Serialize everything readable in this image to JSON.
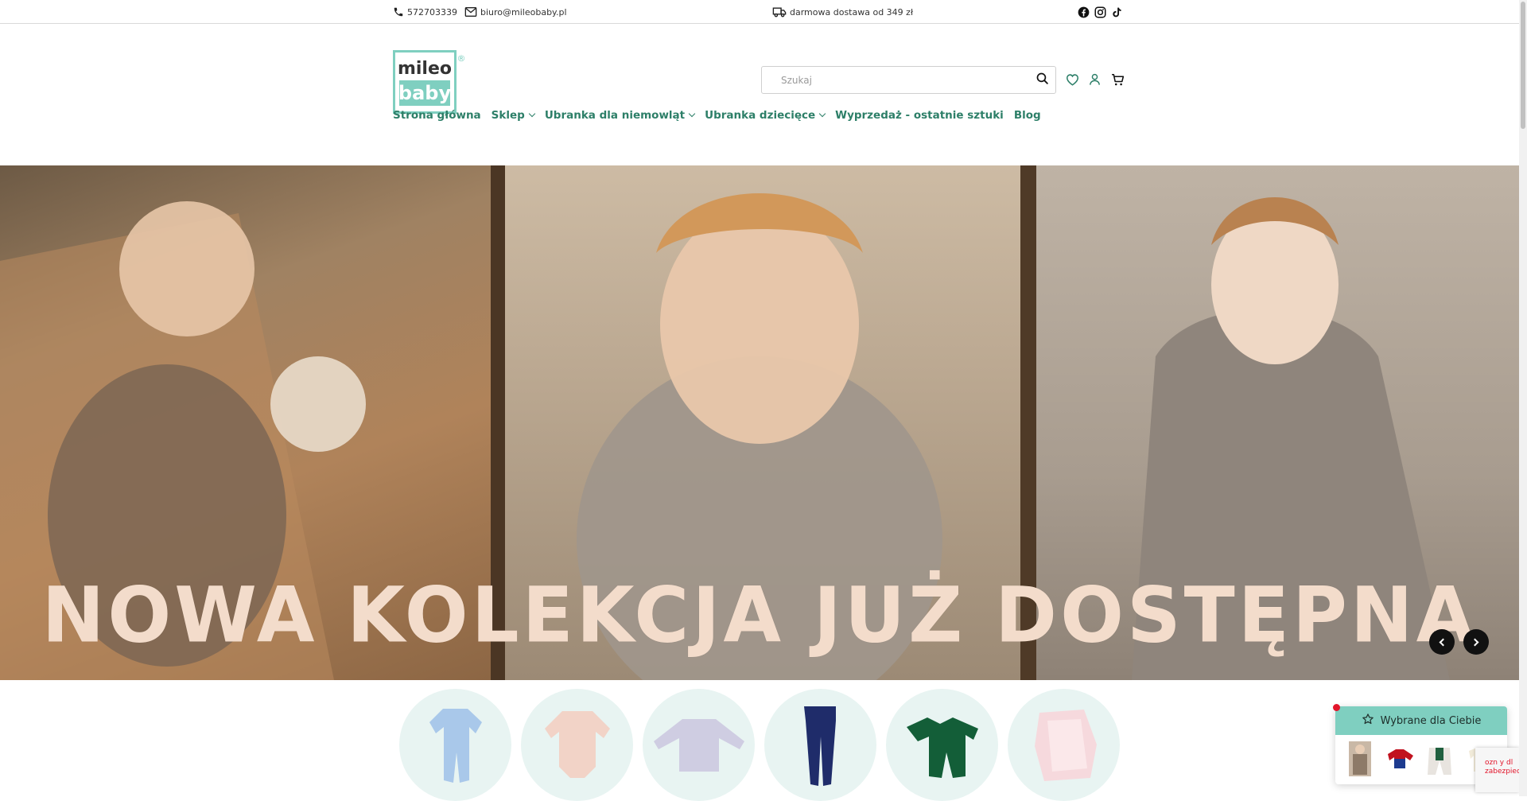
{
  "topbar": {
    "phone": "572703339",
    "email": "biuro@mileobaby.pl",
    "shipping": "darmowa dostawa od 349 zł",
    "social": [
      "facebook-icon",
      "instagram-icon",
      "tiktok-icon"
    ]
  },
  "logo": {
    "line1": "mileo",
    "line2": "baby",
    "mark": "®"
  },
  "search": {
    "placeholder": "Szukaj"
  },
  "header_icons": [
    "heart-icon",
    "user-icon",
    "cart-icon"
  ],
  "nav": {
    "items": [
      {
        "label": "Strona główna",
        "dropdown": false
      },
      {
        "label": "Sklep",
        "dropdown": true
      },
      {
        "label": "Ubranka dla niemowląt",
        "dropdown": true
      },
      {
        "label": "Ubranka dziecięce",
        "dropdown": true
      },
      {
        "label": "Wyprzedaż - ostatnie sztuki",
        "dropdown": false
      },
      {
        "label": "Blog",
        "dropdown": false
      }
    ]
  },
  "hero": {
    "title": "NOWA KOLEKCJA JUŻ DOSTĘPNA",
    "prev_icon": "chevron-left-icon",
    "next_icon": "chevron-right-icon"
  },
  "widget": {
    "title": "Wybrane dla Ciebie"
  },
  "recaptcha": {
    "text": "ozn y dl zabezpiec"
  },
  "colors": {
    "brand": "#2d7f68",
    "accent": "#7fcfc0",
    "category_bg": "#e8f4f2",
    "hero_text": "#f3dccb"
  }
}
